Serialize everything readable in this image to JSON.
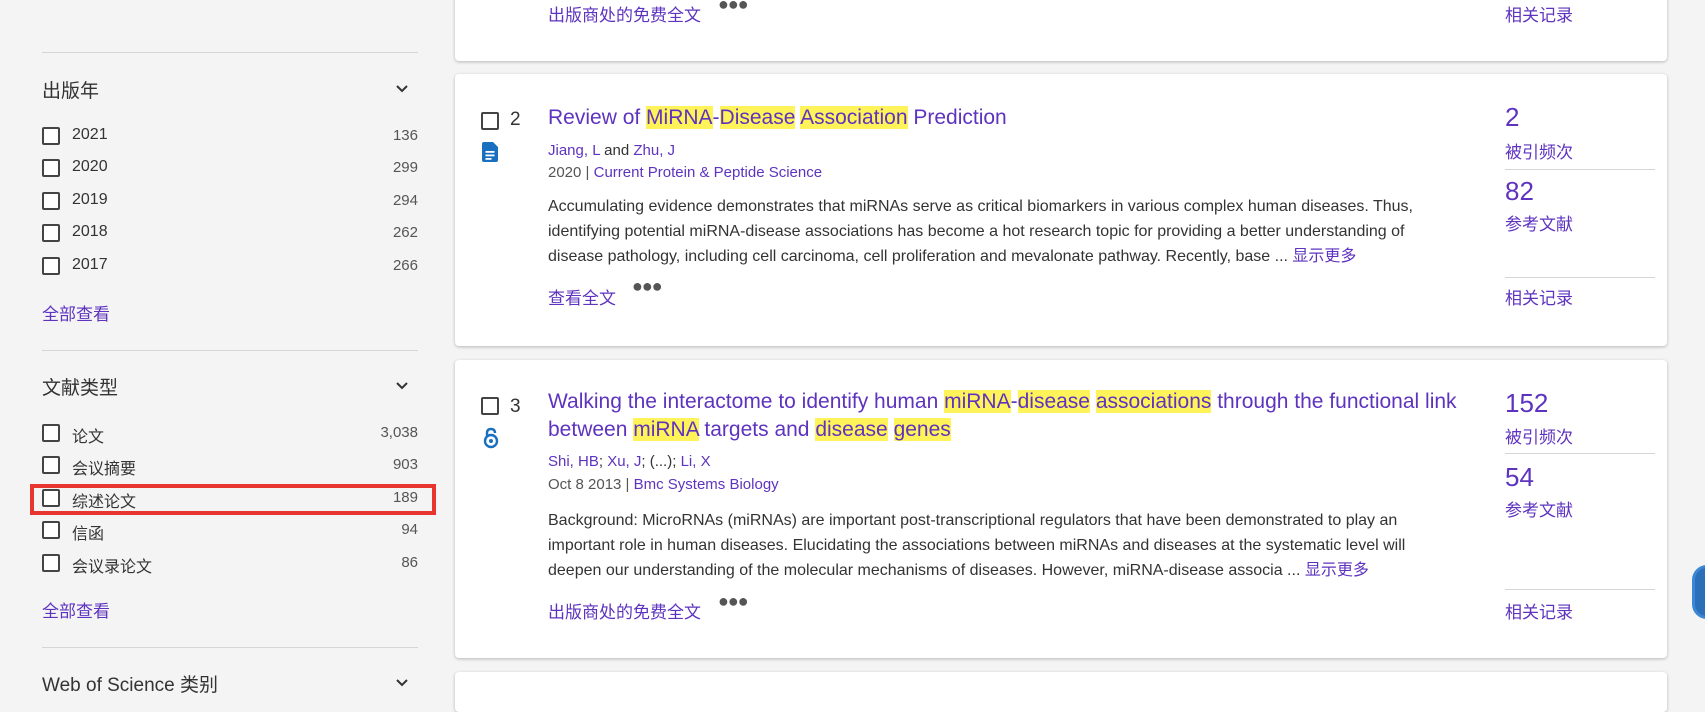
{
  "sidebar": {
    "pub_year": {
      "title": "出版年",
      "items": [
        {
          "label": "2021",
          "count": "136"
        },
        {
          "label": "2020",
          "count": "299"
        },
        {
          "label": "2019",
          "count": "294"
        },
        {
          "label": "2018",
          "count": "262"
        },
        {
          "label": "2017",
          "count": "266"
        }
      ],
      "see_all": "全部查看"
    },
    "doc_type": {
      "title": "文献类型",
      "items": [
        {
          "label": "论文",
          "count": "3,038"
        },
        {
          "label": "会议摘要",
          "count": "903"
        },
        {
          "label": "综述论文",
          "count": "189"
        },
        {
          "label": "信函",
          "count": "94"
        },
        {
          "label": "会议录论文",
          "count": "86"
        }
      ],
      "see_all": "全部查看"
    },
    "wos_category": {
      "title": "Web of Science 类别"
    }
  },
  "results": {
    "prev": {
      "fulltext": "出版商处的免费全文",
      "related": "相关记录"
    },
    "r2": {
      "num": "2",
      "title_parts": [
        "Review of ",
        "MiRNA",
        "-",
        "Disease",
        " ",
        "Association",
        " Prediction"
      ],
      "authors": [
        "Jiang, L",
        " and ",
        "Zhu, J"
      ],
      "year": "2020",
      "journal": "Current Protein & Peptide Science",
      "abstract": "Accumulating evidence demonstrates that miRNAs serve as critical biomarkers in various complex human diseases. Thus, identifying potential miRNA-disease associations has become a hot research topic for providing a better understanding of disease pathology, including cell carcinoma, cell proliferation and mevalonate pathway. Recently, base ...",
      "show_more": "显示更多",
      "fulltext": "查看全文",
      "cited_num": "2",
      "cited_label": "被引频次",
      "refs_num": "82",
      "refs_label": "参考文献",
      "related": "相关记录"
    },
    "r3": {
      "num": "3",
      "title_parts": [
        "Walking the interactome to identify human ",
        "miRNA",
        "-",
        "disease",
        " ",
        "associations",
        " through the functional link between ",
        "miRNA",
        " targets and ",
        "disease",
        " ",
        "genes"
      ],
      "authors": [
        "Shi, HB",
        "; ",
        "Xu, J",
        "; (...); ",
        "Li, X"
      ],
      "date": "Oct 8 2013",
      "journal": "Bmc Systems Biology",
      "abstract": "Background: MicroRNAs (miRNAs) are important post-transcriptional regulators that have been demonstrated to play an important role in human diseases. Elucidating the associations between miRNAs and diseases at the systematic level will deepen our understanding of the molecular mechanisms of diseases. However, miRNA-disease associa ...",
      "show_more": "显示更多",
      "fulltext": "出版商处的免费全文",
      "cited_num": "152",
      "cited_label": "被引频次",
      "refs_num": "54",
      "refs_label": "参考文献",
      "related": "相关记录"
    }
  },
  "colors": {
    "link": "#5e33bf",
    "highlight": "#fff35a",
    "annotation": "#e8352f"
  }
}
